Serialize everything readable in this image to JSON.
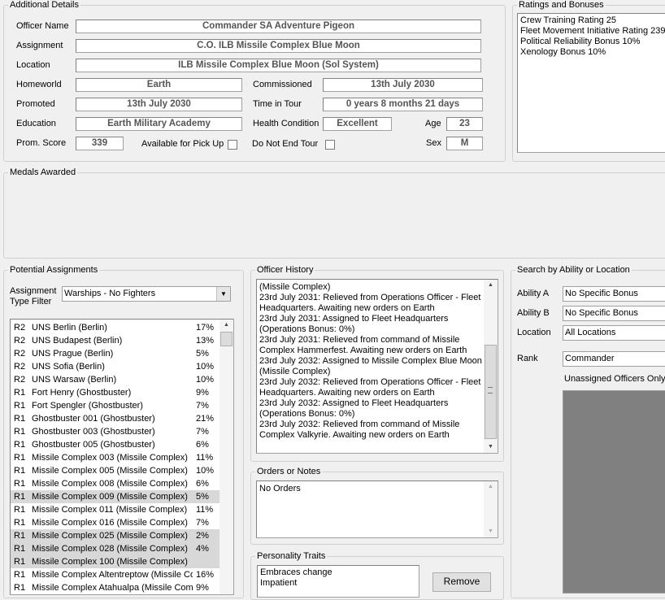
{
  "details": {
    "legend": "Additional Details",
    "officer_name_label": "Officer Name",
    "officer_name": "Commander SA Adventure Pigeon",
    "assignment_label": "Assignment",
    "assignment": "C.O. ILB Missile Complex Blue Moon",
    "location_label": "Location",
    "location": "ILB Missile Complex Blue Moon (Sol System)",
    "homeworld_label": "Homeworld",
    "homeworld": "Earth",
    "commissioned_label": "Commissioned",
    "commissioned": "13th July 2030",
    "promoted_label": "Promoted",
    "promoted": "13th July 2030",
    "time_in_tour_label": "Time in Tour",
    "time_in_tour": "0 years 8 months 21 days",
    "education_label": "Education",
    "education": "Earth Military Academy",
    "health_label": "Health Condition",
    "health": "Excellent",
    "age_label": "Age",
    "age": "23",
    "prom_score_label": "Prom. Score",
    "prom_score": "339",
    "pickup_label": "Available for Pick Up",
    "do_not_end_tour_label": "Do Not End Tour",
    "sex_label": "Sex",
    "sex": "M"
  },
  "ratings": {
    "legend": "Ratings and Bonuses",
    "lines": [
      "Crew Training Rating 25",
      "Fleet Movement Initiative Rating 239",
      "Political Reliability Bonus 10%",
      "Xenology Bonus 10%"
    ]
  },
  "medals": {
    "legend": "Medals Awarded"
  },
  "potential": {
    "legend": "Potential Assignments",
    "filter_label_1": "Assignment",
    "filter_label_2": "Type Filter",
    "filter_value": "Warships - No Fighters",
    "rows": [
      {
        "rank": "R2",
        "name": "UNS Berlin (Berlin)",
        "pct": "17%"
      },
      {
        "rank": "R2",
        "name": "UNS Budapest (Berlin)",
        "pct": "13%"
      },
      {
        "rank": "R2",
        "name": "UNS Prague (Berlin)",
        "pct": "5%"
      },
      {
        "rank": "R2",
        "name": "UNS Sofia (Berlin)",
        "pct": "10%"
      },
      {
        "rank": "R2",
        "name": "UNS Warsaw (Berlin)",
        "pct": "10%"
      },
      {
        "rank": "R1",
        "name": "Fort Henry (Ghostbuster)",
        "pct": "9%"
      },
      {
        "rank": "R1",
        "name": "Fort Spengler (Ghostbuster)",
        "pct": "7%"
      },
      {
        "rank": "R1",
        "name": "Ghostbuster 001 (Ghostbuster)",
        "pct": "21%"
      },
      {
        "rank": "R1",
        "name": "Ghostbuster 003 (Ghostbuster)",
        "pct": "7%"
      },
      {
        "rank": "R1",
        "name": "Ghostbuster 005 (Ghostbuster)",
        "pct": "6%"
      },
      {
        "rank": "R1",
        "name": "Missile Complex 003 (Missile Complex)",
        "pct": "11%"
      },
      {
        "rank": "R1",
        "name": "Missile Complex 005 (Missile Complex)",
        "pct": "10%"
      },
      {
        "rank": "R1",
        "name": "Missile Complex 008 (Missile Complex)",
        "pct": "6%"
      },
      {
        "rank": "R1",
        "name": "Missile Complex 009 (Missile Complex)",
        "pct": "5%"
      },
      {
        "rank": "R1",
        "name": "Missile Complex 011 (Missile Complex)",
        "pct": "11%"
      },
      {
        "rank": "R1",
        "name": "Missile Complex 016 (Missile Complex)",
        "pct": "7%"
      },
      {
        "rank": "R1",
        "name": "Missile Complex 025 (Missile Complex)",
        "pct": "2%"
      },
      {
        "rank": "R1",
        "name": "Missile Complex 028 (Missile Complex)",
        "pct": "4%"
      },
      {
        "rank": "R1",
        "name": "Missile Complex 100 (Missile Complex)",
        "pct": ""
      },
      {
        "rank": "R1",
        "name": "Missile Complex Altentreptow (Missile Com",
        "pct": "16%"
      },
      {
        "rank": "R1",
        "name": "Missile Complex Atahualpa (Missile Comple",
        "pct": "9%"
      }
    ]
  },
  "history": {
    "legend": "Officer History",
    "lines": [
      "(Missile Complex)",
      "23rd July 2031: Relieved from Operations Officer - Fleet",
      "Headquarters. Awaiting new orders on Earth",
      "23rd July 2031: Assigned to Fleet Headquarters",
      "(Operations Bonus: 0%)",
      "23rd July 2031: Relieved from command of Missile",
      "Complex Hammerfest. Awaiting new orders on Earth",
      "23rd July 2032: Assigned to Missile Complex Blue Moon",
      "(Missile Complex)",
      "23rd July 2032: Relieved from Operations Officer - Fleet",
      "Headquarters. Awaiting new orders on Earth",
      "23rd July 2032: Assigned to Fleet Headquarters",
      "(Operations Bonus: 0%)",
      "23rd July 2032: Relieved from command of Missile",
      "Complex Valkyrie. Awaiting new orders on Earth"
    ]
  },
  "orders": {
    "legend": "Orders or Notes",
    "text": "No Orders"
  },
  "traits": {
    "legend": "Personality Traits",
    "lines": [
      "Embraces change",
      "Impatient"
    ],
    "remove_label": "Remove"
  },
  "search": {
    "legend": "Search by Ability or Location",
    "ability_a_label": "Ability A",
    "ability_a": "No Specific Bonus",
    "ability_b_label": "Ability B",
    "ability_b": "No Specific Bonus",
    "location_label": "Location",
    "location": "All Locations",
    "rank_label": "Rank",
    "rank": "Commander",
    "unassigned_label": "Unassigned Officers Only"
  },
  "colors": {
    "panel": "#f0f0f0",
    "field_text": "#555555",
    "list_selected": "#d8d8d8",
    "results_area": "#808080"
  }
}
